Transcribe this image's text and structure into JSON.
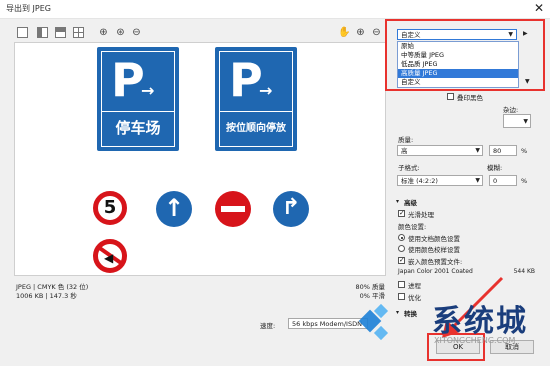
{
  "window": {
    "title": "导出到 JPEG",
    "close": "✕"
  },
  "preview_info": {
    "format_line": "JPEG | CMYK 色 (32 位)",
    "size_line": "1006 KB | 147.3 秒",
    "quality_line": "80% 质量",
    "smooth_line": "0% 平滑"
  },
  "speed": {
    "label": "速度:",
    "value": "56 kbps Modem/ISDN"
  },
  "preset": {
    "value": "自定义",
    "options": [
      "原始",
      "中等质量 JPEG",
      "低品质 JPEG",
      "高质量 JPEG",
      "自定义"
    ],
    "selected_index": 3
  },
  "options": {
    "overprint_label": "叠印黑色",
    "noise_label": "杂边:",
    "quality_label": "质量:",
    "quality_value": "高",
    "quality_num": "80",
    "percent": "%",
    "subformat_label": "子格式:",
    "subformat_value": "标准 (4:2:2)",
    "blur_label": "模糊:",
    "blur_value": "0"
  },
  "advanced": {
    "header": "高级",
    "antialias_label": "光滑处理",
    "color_settings_label": "颜色设置:",
    "use_doc_color": "使用文档颜色设置",
    "use_proof": "使用颜色校样设置",
    "embed_profile": "嵌入颜色预置文件:",
    "profile_name": "Japan Color 2001 Coated",
    "profile_size": "544 KB",
    "progressive": "进程",
    "optimize": "优化",
    "transform": "转换"
  },
  "buttons": {
    "ok": "OK",
    "cancel": "取消"
  },
  "signs": {
    "parking1": "停车场",
    "parking2": "按位顺向停放",
    "p": "P",
    "speed": "5"
  },
  "watermark": {
    "brand": "系统城",
    "url": "XITONGCHENG.COM"
  },
  "colors": {
    "sign_blue": "#1f67b1",
    "red": "#d7141a",
    "accent": "#e8322e"
  }
}
